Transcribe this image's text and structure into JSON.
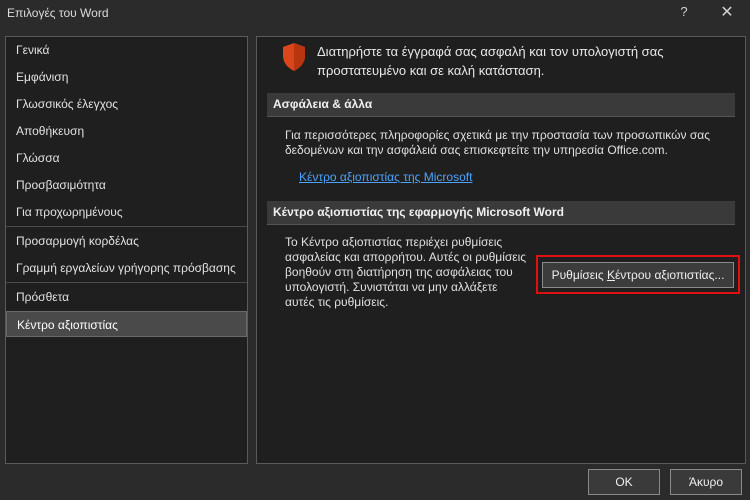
{
  "window": {
    "title": "Επιλογές του Word",
    "help_glyph": "?",
    "close_glyph": "✕"
  },
  "sidebar": {
    "items": [
      {
        "label": "Γενικά"
      },
      {
        "label": "Εμφάνιση"
      },
      {
        "label": "Γλωσσικός έλεγχος"
      },
      {
        "label": "Αποθήκευση"
      },
      {
        "label": "Γλώσσα"
      },
      {
        "label": "Προσβασιμότητα"
      },
      {
        "label": "Για προχωρημένους"
      },
      {
        "label": "Προσαρμογή κορδέλας"
      },
      {
        "label": "Γραμμή εργαλείων γρήγορης πρόσβασης"
      },
      {
        "label": "Πρόσθετα"
      },
      {
        "label": "Κέντρο αξιοπιστίας",
        "selected": true
      }
    ]
  },
  "main": {
    "header_icon": "shield-icon",
    "header_text": "Διατηρήστε τα έγγραφά σας ασφαλή και τον υπολογιστή σας προστατευμένο και σε καλή κατάσταση.",
    "security": {
      "heading": "Ασφάλεια & άλλα",
      "description": "Για περισσότερες πληροφορίες σχετικά με την προστασία των προσωπικών σας δεδομένων και την ασφάλειά σας επισκεφτείτε την υπηρεσία Office.com.",
      "link": "Κέντρο αξιοπιστίας της Microsoft"
    },
    "trust_center": {
      "heading": "Κέντρο αξιοπιστίας της εφαρμογής Microsoft Word",
      "description": "Το Κέντρο αξιοπιστίας περιέχει ρυθμίσεις ασφαλείας και απορρήτου. Αυτές οι ρυθμίσεις βοηθούν στη διατήρηση της ασφάλειας του υπολογιστή. Συνιστάται να μην αλλάξετε αυτές τις ρυθμίσεις.",
      "button_before": "Ρυθμίσεις ",
      "button_accel": "Κ",
      "button_after": "έντρου αξιοπιστίας..."
    }
  },
  "footer": {
    "ok": "OK",
    "cancel": "Άκυρο"
  },
  "colors": {
    "accent_shield": "#d9461c",
    "link": "#4da3ff",
    "highlight_box": "#e01010"
  }
}
